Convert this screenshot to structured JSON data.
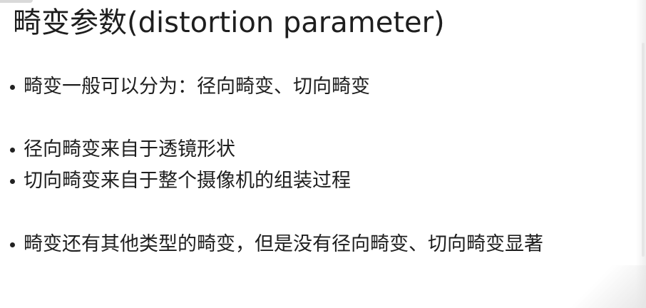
{
  "slide": {
    "title": "畸变参数(distortion parameter)",
    "bullets": [
      "畸变一般可以分为：径向畸变、切向畸变",
      "径向畸变来自于透镜形状",
      "切向畸变来自于整个摄像机的组装过程",
      "畸变还有其他类型的畸变，但是没有径向畸变、切向畸变显著"
    ]
  },
  "colors": {
    "background": "#ffffff",
    "text": "#1e1e1e",
    "bullet": "#222222"
  }
}
